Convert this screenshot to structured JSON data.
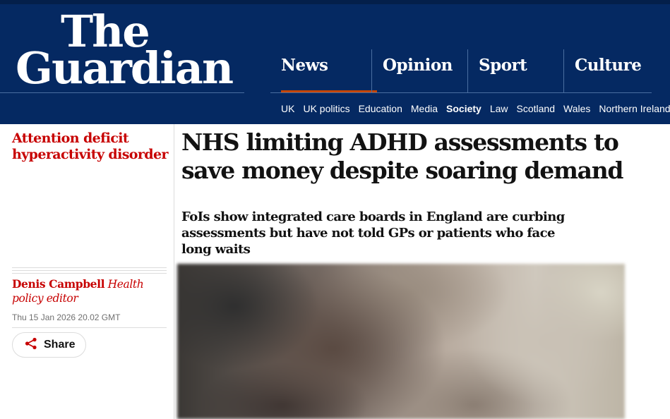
{
  "brand": {
    "logo_line1": "The",
    "logo_line2": "Guardian",
    "colors": {
      "masthead": "#052962",
      "accent": "#c70000",
      "pillar_underline": "#c74600"
    }
  },
  "nav": {
    "pillars": [
      {
        "label": "News",
        "active": true
      },
      {
        "label": "Opinion",
        "active": false
      },
      {
        "label": "Sport",
        "active": false
      },
      {
        "label": "Culture",
        "active": false
      }
    ],
    "subnav": [
      {
        "label": "UK",
        "active": false
      },
      {
        "label": "UK politics",
        "active": false
      },
      {
        "label": "Education",
        "active": false
      },
      {
        "label": "Media",
        "active": false
      },
      {
        "label": "Society",
        "active": true
      },
      {
        "label": "Law",
        "active": false
      },
      {
        "label": "Scotland",
        "active": false
      },
      {
        "label": "Wales",
        "active": false
      },
      {
        "label": "Northern Ireland",
        "active": false
      }
    ]
  },
  "article": {
    "section": "Attention deficit hyperactivity disorder",
    "headline": "NHS limiting ADHD assessments to save money despite soaring demand",
    "standfirst": "FoIs show integrated care boards in England are curbing assessments but have not told GPs or patients who face long waits",
    "byline_name": "Denis Campbell",
    "byline_role": "Health policy editor",
    "dateline": "Thu 15 Jan 2026 20.02 GMT",
    "share_label": "Share",
    "share_icon": "share-icon"
  }
}
